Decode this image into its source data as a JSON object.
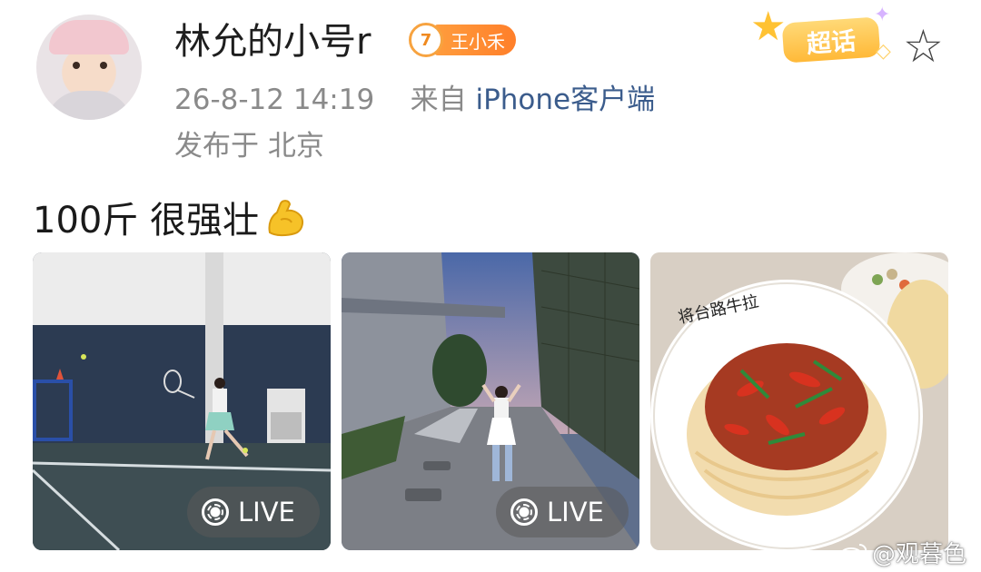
{
  "post": {
    "author": "林允的小号r",
    "fan_badge": {
      "level": "7",
      "name": "王小禾"
    },
    "timestamp": "26-8-12 14:19",
    "source_prefix": "来自",
    "source_client": "iPhone客户端",
    "location": "发布于 北京",
    "supertopic_label": "超话",
    "text": "100斤 很强壮",
    "text_emoji": "flexed-biceps"
  },
  "photos": [
    {
      "name": "tennis-court-photo",
      "live_label": "LIVE"
    },
    {
      "name": "street-evening-photo",
      "live_label": "LIVE"
    },
    {
      "name": "noodle-dish-photo",
      "bowl_text": "将台路牛拉"
    }
  ],
  "watermark": "@观暮色",
  "colors": {
    "link": "#3b5c8c",
    "meta": "#8a8a8a",
    "badge_orange": "#ff8c2e",
    "supertopic_yellow": "#ffc233"
  }
}
